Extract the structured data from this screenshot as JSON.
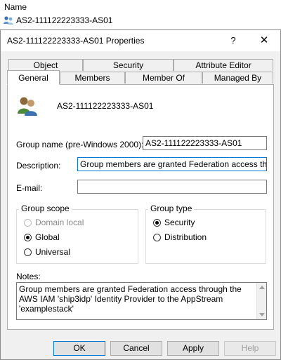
{
  "background": {
    "column_header": "Name",
    "row_name": "AS2-111122223333-AS01"
  },
  "dialog": {
    "title": "AS2-111122223333-AS01 Properties",
    "help_glyph": "?",
    "close_glyph": "✕",
    "tabs_row1": [
      "Object",
      "Security",
      "Attribute Editor"
    ],
    "tabs_row2": [
      "General",
      "Members",
      "Member Of",
      "Managed By"
    ],
    "active_tab": "General"
  },
  "general": {
    "group_display_name": "AS2-111122223333-AS01",
    "group_name_label": "Group name (pre-Windows 2000):",
    "group_name_value": "AS2-111122223333-AS01",
    "description_label": "Description:",
    "description_value": "Group members are granted Federation access through t",
    "email_label": "E-mail:",
    "email_value": "",
    "group_scope": {
      "legend": "Group scope",
      "options": [
        "Domain local",
        "Global",
        "Universal"
      ],
      "selected": "Global"
    },
    "group_type": {
      "legend": "Group type",
      "options": [
        "Security",
        "Distribution"
      ],
      "selected": "Security"
    },
    "notes_label": "Notes:",
    "notes_value": "Group members are granted Federation access through the AWS IAM 'ship3idp' Identity Provider to the AppStream 'examplestack'"
  },
  "buttons": {
    "ok": "OK",
    "cancel": "Cancel",
    "apply": "Apply",
    "help": "Help"
  }
}
